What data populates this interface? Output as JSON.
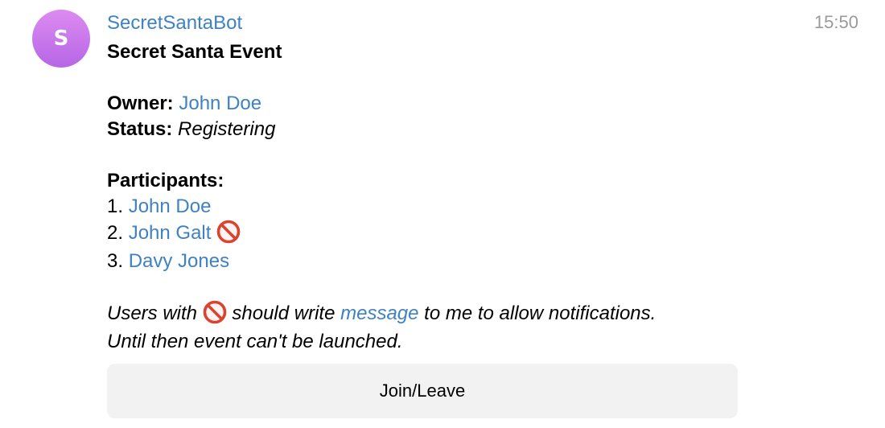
{
  "bot": {
    "avatar_letter": "S",
    "name": "SecretSantaBot",
    "time": "15:50"
  },
  "message": {
    "title": "Secret Santa Event",
    "owner_label": "Owner:",
    "owner_name": "John Doe",
    "status_label": "Status:",
    "status_value": "Registering",
    "participants_label": "Participants:",
    "participants": [
      {
        "num": "1.",
        "name": "John Doe",
        "blocked": false
      },
      {
        "num": "2.",
        "name": "John Galt",
        "blocked": true
      },
      {
        "num": "3.",
        "name": "Davy Jones",
        "blocked": false
      }
    ],
    "notice_part1": "Users with",
    "notice_part2": "should write",
    "notice_link": "message",
    "notice_part3": "to me to allow notifications.",
    "notice_line2": "Until then event can't be launched."
  },
  "button": {
    "label": "Join/Leave"
  },
  "icons": {
    "blocked": "no-entry-icon"
  },
  "colors": {
    "link": "#3f82c2",
    "time": "#9a9a9a",
    "avatar": "#c77aea",
    "button_bg": "#f2f2f2"
  }
}
